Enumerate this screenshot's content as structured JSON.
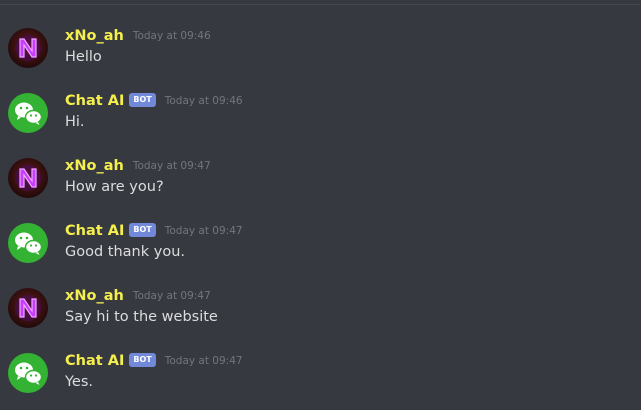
{
  "colors": {
    "background": "#36393f",
    "username_accent": "#f4ee4e",
    "bot_tag": "#7289da",
    "timestamp": "#72767d",
    "message_text": "#dcddde"
  },
  "messages": [
    {
      "author": "xNo_ah",
      "avatar_icon": "neon-n-icon",
      "bot": false,
      "timestamp": "Today at 09:46",
      "content": "Hello"
    },
    {
      "author": "Chat AI",
      "avatar_icon": "wechat-icon",
      "bot": true,
      "bot_tag": "BOT",
      "timestamp": "Today at 09:46",
      "content": "Hi."
    },
    {
      "author": "xNo_ah",
      "avatar_icon": "neon-n-icon",
      "bot": false,
      "timestamp": "Today at 09:47",
      "content": "How are you?"
    },
    {
      "author": "Chat AI",
      "avatar_icon": "wechat-icon",
      "bot": true,
      "bot_tag": "BOT",
      "timestamp": "Today at 09:47",
      "content": "Good thank you."
    },
    {
      "author": "xNo_ah",
      "avatar_icon": "neon-n-icon",
      "bot": false,
      "timestamp": "Today at 09:47",
      "content": "Say hi to the website"
    },
    {
      "author": "Chat AI",
      "avatar_icon": "wechat-icon",
      "bot": true,
      "bot_tag": "BOT",
      "timestamp": "Today at 09:47",
      "content": "Yes."
    }
  ]
}
